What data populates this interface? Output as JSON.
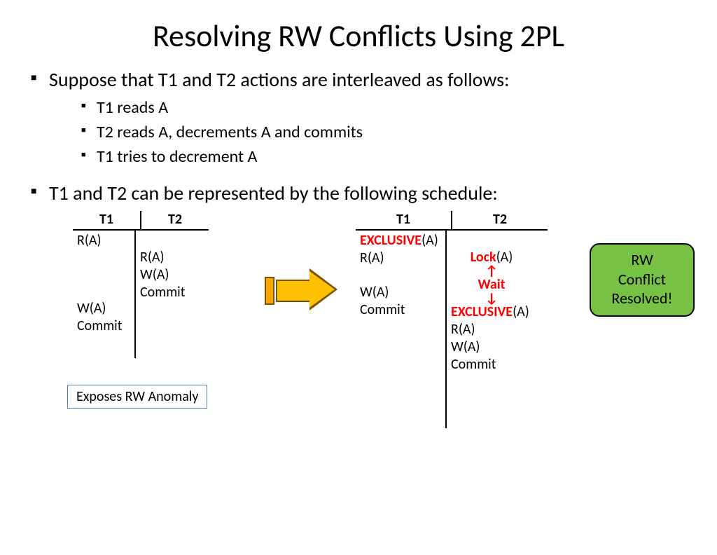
{
  "title": "Resolving RW Conflicts Using 2PL",
  "bullets": {
    "b1": "Suppose that T1 and T2 actions are interleaved as follows:",
    "s1": "T1 reads A",
    "s2": "T2 reads A, decrements A and commits",
    "s3": "T1 tries to decrement A",
    "b2": "T1 and T2 can be represented by the following schedule:"
  },
  "leftSched": {
    "h1": "T1",
    "h2": "T2",
    "t1": {
      "r": "R(A)",
      "w": "W(A)",
      "c": "Commit"
    },
    "t2": {
      "r": "R(A)",
      "w": "W(A)",
      "c": "Commit"
    }
  },
  "rightSched": {
    "h1": "T1",
    "h2": "T2",
    "t1": {
      "ex_pre": "EXCLUSIVE",
      "ex_arg": "(A)",
      "r": "R(A)",
      "w": "W(A)",
      "c": "Commit"
    },
    "t2": {
      "lock_pre": "Lock",
      "lock_arg": "(A)",
      "wait": "Wait",
      "ex_pre": "EXCLUSIVE",
      "ex_arg": "(A)",
      "r": "R(A)",
      "w": "W(A)",
      "c": "Commit"
    }
  },
  "anomalyLabel": "Exposes RW Anomaly",
  "resolved": {
    "l1": "RW",
    "l2": "Conflict",
    "l3": "Resolved!"
  }
}
